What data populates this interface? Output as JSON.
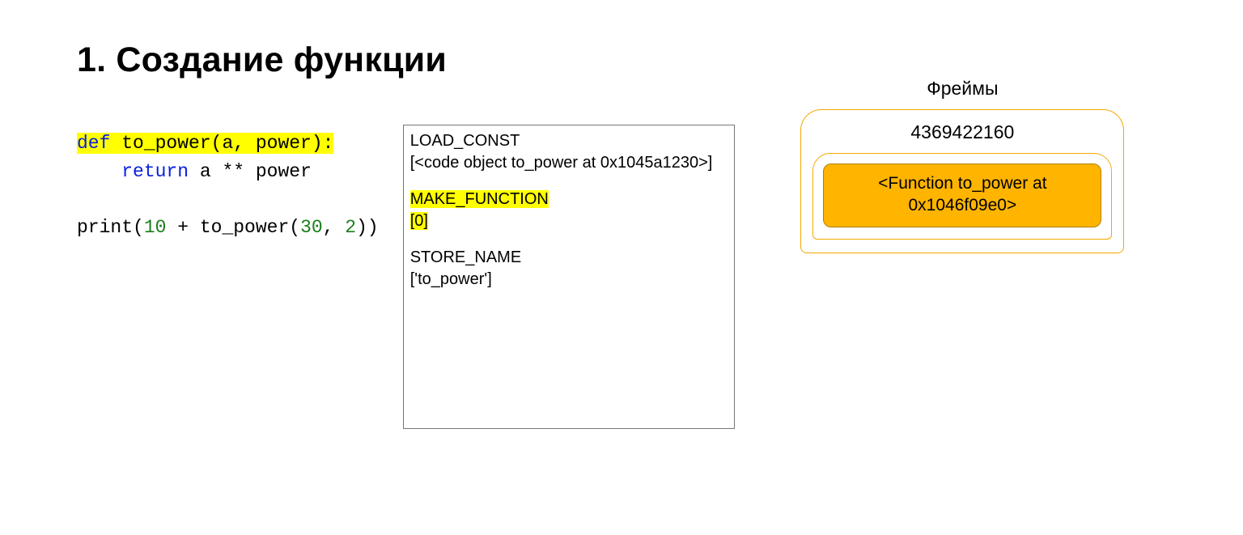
{
  "title": "1. Создание функции",
  "code": {
    "line1": {
      "def": "def",
      "rest": " to_power(a, power):"
    },
    "line2": {
      "indent": "    ",
      "ret": "return",
      "rest": " a ** power"
    },
    "line3": {
      "p1": "print(",
      "n1": "10",
      "p2": " + to_power(",
      "n2": "30",
      "p3": ", ",
      "n3": "2",
      "p4": "))"
    }
  },
  "bytecode": {
    "b1_op": "LOAD_CONST",
    "b1_arg": "[<code object to_power at 0x1045a1230>]",
    "b2_op": "MAKE_FUNCTION",
    "b2_arg": "[0]",
    "b3_op": "STORE_NAME",
    "b3_arg": "['to_power']"
  },
  "frames": {
    "label": "Фреймы",
    "id": "4369422160",
    "top": "<Function to_power at 0x1046f09e0>"
  }
}
